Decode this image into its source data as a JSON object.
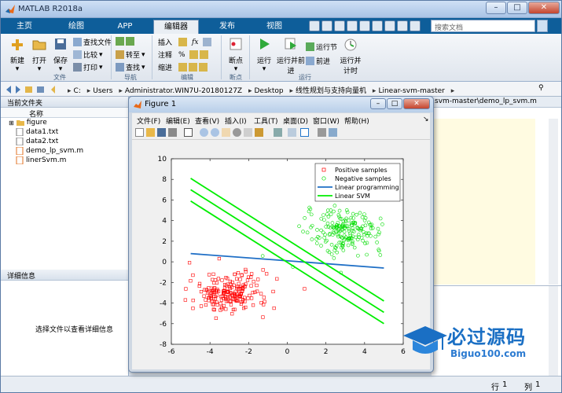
{
  "window": {
    "title": "MATLAB R2018a"
  },
  "tabs": [
    "主页",
    "绘图",
    "APP",
    "编辑器",
    "发布",
    "视图"
  ],
  "active_tab": "编辑器",
  "search": {
    "placeholder": "搜索文档"
  },
  "ribbon": {
    "new": "新建",
    "open": "打开",
    "save": "保存",
    "find_files": "查找文件",
    "compare": "比较",
    "print": "打印",
    "goto": "转至",
    "find": "查找",
    "insert": "插入",
    "comment": "注释",
    "indent": "缩进",
    "breakpoints": "断点",
    "run": "运行",
    "run_advance": "运行并前进",
    "run_section": "运行节",
    "advance": "前进",
    "run_time": "运行并计时",
    "groups": {
      "file": "文件",
      "navigate": "导航",
      "edit": "编辑",
      "breakpoints": "断点",
      "run": "运行"
    }
  },
  "path": [
    "C:",
    "Users",
    "Administrator.WIN7U-20180127Z",
    "Desktop",
    "线性规划与支持向量机",
    "Linear-svm-master"
  ],
  "current_folder": {
    "title": "当前文件夹",
    "column": "名称",
    "files": [
      "figure",
      "data1.txt",
      "data2.txt",
      "demo_lp_svm.m",
      "linerSvm.m"
    ]
  },
  "details": {
    "title": "详细信息",
    "message": "选择文件以查看详细信息"
  },
  "editor": {
    "tab": "svm-master\\demo_lp_svm.m"
  },
  "status": {
    "row_label": "行",
    "row": "1",
    "col_label": "列",
    "col": "1"
  },
  "watermark": {
    "text": "必过源码",
    "url": "Biguo100.com"
  },
  "figure": {
    "title": "Figure 1",
    "menu": [
      "文件(F)",
      "编辑(E)",
      "查看(V)",
      "插入(I)",
      "工具(T)",
      "桌面(D)",
      "窗口(W)",
      "帮助(H)"
    ]
  },
  "colors": {
    "positive": "#ff0000",
    "negative": "#00dd00",
    "lp": "#1f6fc6",
    "svm": "#00ee00"
  },
  "chart_data": {
    "type": "scatter",
    "xlim": [
      -6,
      6
    ],
    "ylim": [
      -8,
      10
    ],
    "xticks": [
      -6,
      -4,
      -2,
      0,
      2,
      4,
      6
    ],
    "yticks": [
      -8,
      -6,
      -4,
      -2,
      0,
      2,
      4,
      6,
      8,
      10
    ],
    "legend_position": "top-right",
    "series": [
      {
        "name": "Positive samples",
        "type": "scatter",
        "marker": "square",
        "color": "#ff0000",
        "center": [
          -3,
          -3
        ],
        "spread": [
          1.0,
          1.0
        ],
        "count": 200
      },
      {
        "name": "Negative samples",
        "type": "scatter",
        "marker": "circle",
        "color": "#00dd00",
        "center": [
          3,
          3
        ],
        "spread": [
          1.0,
          1.0
        ],
        "count": 200
      },
      {
        "name": "Linear programming",
        "type": "line",
        "color": "#1f6fc6",
        "points": [
          [
            -5,
            0.8
          ],
          [
            5,
            -0.6
          ]
        ]
      },
      {
        "name": "Linear SVM",
        "type": "line",
        "color": "#00ee00",
        "lines": [
          {
            "points": [
              [
                -5,
                8.1
              ],
              [
                5,
                -3.8
              ]
            ]
          },
          {
            "points": [
              [
                -5,
                7.0
              ],
              [
                5,
                -4.9
              ]
            ]
          },
          {
            "points": [
              [
                -5,
                5.9
              ],
              [
                5,
                -6.0
              ]
            ]
          }
        ]
      }
    ]
  }
}
